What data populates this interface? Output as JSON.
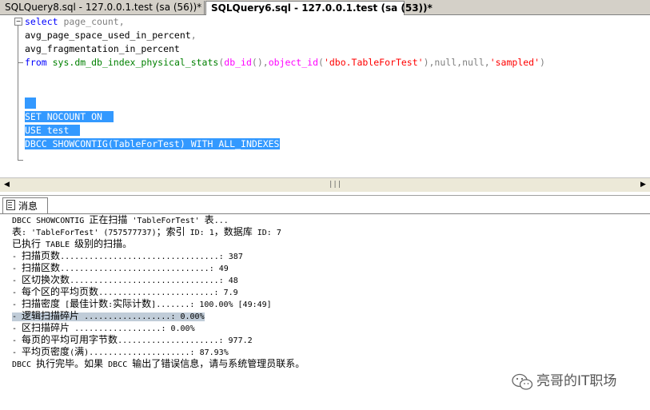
{
  "tabs": [
    {
      "label": "SQLQuery8.sql - 127.0.0.1.test (sa (56))*"
    },
    {
      "label": "SQLQuery6.sql - 127.0.0.1.test (sa (53))*"
    }
  ],
  "editor": {
    "lines": [
      {
        "parts": [
          {
            "t": "select ",
            "c": "kw"
          },
          {
            "t": "page_count,",
            "c": "gray"
          }
        ]
      },
      {
        "parts": [
          {
            "t": "avg_page_space_used_in_percent",
            "c": ""
          },
          {
            "t": ",",
            "c": "gray"
          }
        ]
      },
      {
        "parts": [
          {
            "t": "avg_fragmentation_in_percent",
            "c": ""
          }
        ]
      },
      {
        "parts": [
          {
            "t": "from ",
            "c": "kw"
          },
          {
            "t": "sys.dm_db_index_physical_stats",
            "c": "sys"
          },
          {
            "t": "(",
            "c": "gray"
          },
          {
            "t": "db_id",
            "c": "fn"
          },
          {
            "t": "(),",
            "c": "gray"
          },
          {
            "t": "object_id",
            "c": "fn"
          },
          {
            "t": "(",
            "c": "gray"
          },
          {
            "t": "'dbo.TableForTest'",
            "c": "str"
          },
          {
            "t": "),",
            "c": "gray"
          },
          {
            "t": "null",
            "c": "gray"
          },
          {
            "t": ",",
            "c": "gray"
          },
          {
            "t": "null",
            "c": "gray"
          },
          {
            "t": ",",
            "c": "gray"
          },
          {
            "t": "'sampled'",
            "c": "str"
          },
          {
            "t": ")",
            "c": "gray"
          }
        ]
      },
      {
        "parts": []
      },
      {
        "parts": []
      },
      {
        "parts": [
          {
            "t": "  ",
            "c": "sel"
          }
        ]
      },
      {
        "parts": [
          {
            "t": "SET NOCOUNT ON  ",
            "c": "sel"
          }
        ]
      },
      {
        "parts": [
          {
            "t": "USE test  ",
            "c": "sel"
          }
        ]
      },
      {
        "parts": [
          {
            "t": "DBCC SHOWCONTIG(TableForTest) WITH ALL_INDEXES",
            "c": "sel"
          }
        ]
      }
    ]
  },
  "results": {
    "tab_label": "消息",
    "messages": [
      "DBCC SHOWCONTIG 正在扫描 'TableForTest' 表...",
      "表: 'TableForTest' (757577737)；索引 ID: 1，数据库 ID: 7",
      "已执行 TABLE 级别的扫描。",
      "- 扫描页数.................................: 387",
      "- 扫描区数...............................: 49",
      "- 区切换次数...............................: 48",
      "- 每个区的平均页数........................: 7.9",
      "- 扫描密度 [最佳计数:实际计数].......: 100.00% [49:49]",
      "- 逻辑扫描碎片 ..................: 0.00%",
      "- 区扫描碎片 ..................: 0.00%",
      "- 每页的平均可用字节数.....................: 977.2",
      "- 平均页密度(满).....................: 87.93%",
      "DBCC 执行完毕。如果 DBCC 输出了错误信息，请与系统管理员联系。"
    ],
    "highlighted_index": 8
  },
  "watermark": {
    "text": "亮哥的IT职场",
    "icon": "wechat-icon"
  }
}
